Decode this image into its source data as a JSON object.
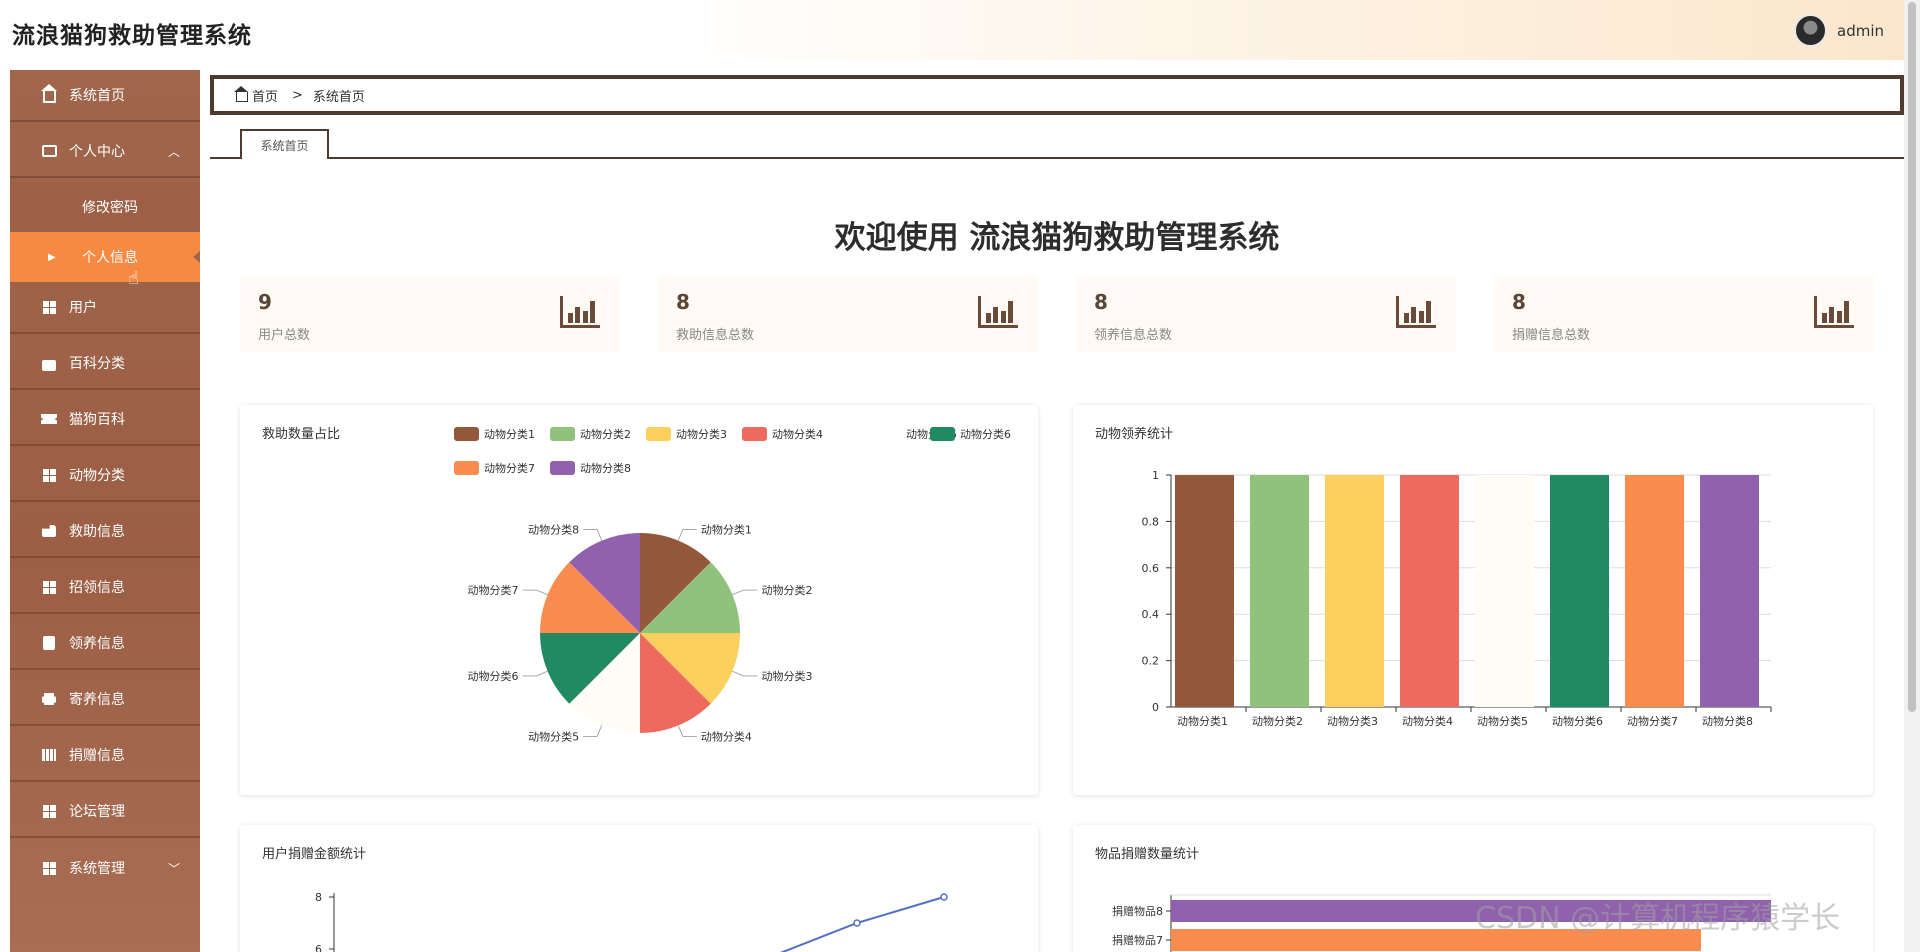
{
  "app": {
    "title": "流浪猫狗救助管理系统"
  },
  "user": {
    "name": "admin"
  },
  "sidebar": {
    "items": [
      {
        "label": "系统首页",
        "icon": "home-icon"
      },
      {
        "label": "个人中心",
        "icon": "wallet-icon",
        "expanded": true
      },
      {
        "label": "修改密码"
      },
      {
        "label": "个人信息",
        "active": true
      },
      {
        "label": "用户",
        "icon": "grid-icon"
      },
      {
        "label": "百科分类",
        "icon": "briefcase-icon"
      },
      {
        "label": "猫狗百科",
        "icon": "ticket-icon"
      },
      {
        "label": "动物分类",
        "icon": "grid-icon"
      },
      {
        "label": "救助信息",
        "icon": "hand-icon"
      },
      {
        "label": "招领信息",
        "icon": "grid-icon"
      },
      {
        "label": "领养信息",
        "icon": "clipboard-icon"
      },
      {
        "label": "寄养信息",
        "icon": "printer-icon"
      },
      {
        "label": "捐赠信息",
        "icon": "book-icon"
      },
      {
        "label": "论坛管理",
        "icon": "grid-icon"
      },
      {
        "label": "系统管理",
        "icon": "grid-icon",
        "expanded": false
      }
    ]
  },
  "breadcrumb": {
    "home": "首页",
    "separator": ">",
    "current": "系统首页"
  },
  "tabs": [
    {
      "label": "系统首页"
    }
  ],
  "welcome": "欢迎使用 流浪猫狗救助管理系统",
  "stats": [
    {
      "value": "9",
      "label": "用户总数"
    },
    {
      "value": "8",
      "label": "救助信息总数"
    },
    {
      "value": "8",
      "label": "领养信息总数"
    },
    {
      "value": "8",
      "label": "捐赠信息总数"
    }
  ],
  "panels": {
    "pie_title": "救助数量占比",
    "bar_title": "动物领养统计",
    "line_title": "用户捐赠金额统计",
    "hbar_title": "物品捐赠数量统计"
  },
  "colors": {
    "brand": "#a0654b",
    "active": "#f78a43",
    "series": [
      "#93573a",
      "#8fc27a",
      "#fbd05e",
      "#ee6a5f",
      "#fffcf5",
      "#228a63",
      "#f98c4e",
      "#9061ad"
    ]
  },
  "chart_data": [
    {
      "type": "pie",
      "title": "救助数量占比",
      "categories": [
        "动物分类1",
        "动物分类2",
        "动物分类3",
        "动物分类4",
        "动物分类5",
        "动物分类6",
        "动物分类7",
        "动物分类8"
      ],
      "values": [
        1,
        1,
        1,
        1,
        1,
        1,
        1,
        1
      ],
      "legend": "top"
    },
    {
      "type": "bar",
      "title": "动物领养统计",
      "categories": [
        "动物分类1",
        "动物分类2",
        "动物分类3",
        "动物分类4",
        "动物分类5",
        "动物分类6",
        "动物分类7",
        "动物分类8"
      ],
      "values": [
        1,
        1,
        1,
        1,
        1,
        1,
        1,
        1
      ],
      "ylim": [
        0,
        1
      ],
      "yticks": [
        "0",
        "0.2",
        "0.4",
        "0.6",
        "0.8",
        "1"
      ],
      "grid": true
    },
    {
      "type": "line",
      "title": "用户捐赠金额统计",
      "yticks_visible": [
        "8",
        "6"
      ],
      "points_visible": [
        {
          "y": 7
        },
        {
          "y": 8
        }
      ]
    },
    {
      "type": "bar",
      "orientation": "horizontal",
      "title": "物品捐赠数量统计",
      "categories_visible": [
        "捐赠物品8",
        "捐赠物品7"
      ]
    }
  ],
  "watermark": "CSDN @计算机程序猿学长"
}
